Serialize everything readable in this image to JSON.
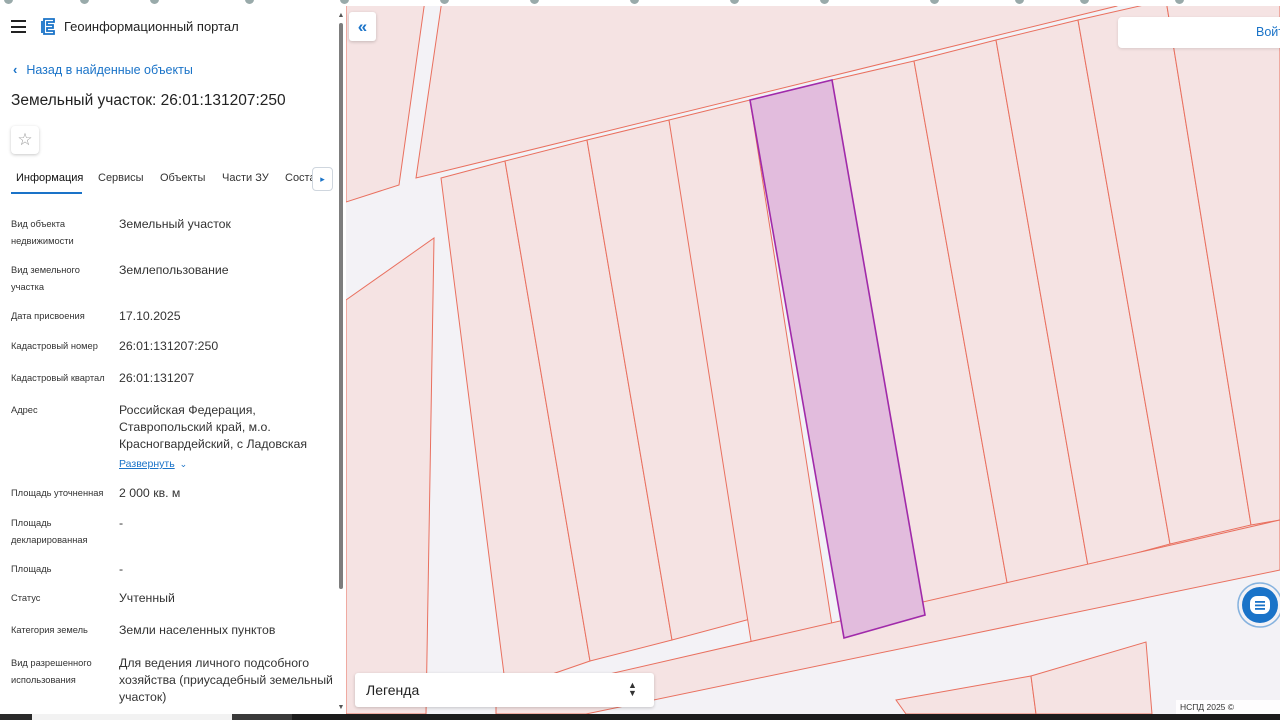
{
  "portal": {
    "title": "Геоинформационный портал"
  },
  "nav": {
    "back_label": "Назад в найденные объекты"
  },
  "object": {
    "title": "Земельный участок: 26:01:131207:250"
  },
  "tabs": [
    {
      "label": "Информация"
    },
    {
      "label": "Сервисы"
    },
    {
      "label": "Объекты"
    },
    {
      "label": "Части ЗУ"
    },
    {
      "label": "Соста"
    }
  ],
  "info": {
    "rows": [
      {
        "label": "Вид объекта недвижимости",
        "value": "Земельный участок"
      },
      {
        "label": "Вид земельного участка",
        "value": "Землепользование"
      },
      {
        "label": "Дата присвоения",
        "value": "17.10.2025"
      },
      {
        "label": "Кадастровый номер",
        "value": "26:01:131207:250"
      },
      {
        "label": "Кадастровый квартал",
        "value": "26:01:131207"
      },
      {
        "label": "Адрес",
        "value": "Российская Федерация, Ставропольский край, м.о. Красногвардейский, с Ладовская"
      },
      {
        "label": "Площадь уточненная",
        "value": "2 000 кв. м"
      },
      {
        "label": "Площадь декларированная",
        "value": "-"
      },
      {
        "label": "Площадь",
        "value": "-"
      },
      {
        "label": "Статус",
        "value": "Учтенный"
      },
      {
        "label": "Категория земель",
        "value": "Земли населенных пунктов"
      },
      {
        "label": "Вид разрешенного использования",
        "value": "Для ведения личного подсобного хозяйства (приусадебный земельный участок)"
      }
    ],
    "expand_label": "Развернуть"
  },
  "map": {
    "login_label": "Войт",
    "legend_label": "Легенда",
    "copyright": "НСПД 2025 ©",
    "colors": {
      "background": "#f3f2f6",
      "parcel_fill": "#f5e3e3",
      "parcel_border": "#e9705f",
      "selected_fill": "#e2bcdd",
      "selected_border": "#a02aaa",
      "accent": "#1a73c8"
    }
  },
  "icons": {
    "menu": "menu-icon",
    "logo": "portal-logo-icon",
    "back": "chevron-left-icon",
    "favorite": "star-icon",
    "tabs_next": "chevron-right-icon",
    "collapse": "double-chevron-left-icon",
    "expand": "chevron-down-icon",
    "legend_toggle": "sort-icon",
    "chat": "chat-icon"
  }
}
